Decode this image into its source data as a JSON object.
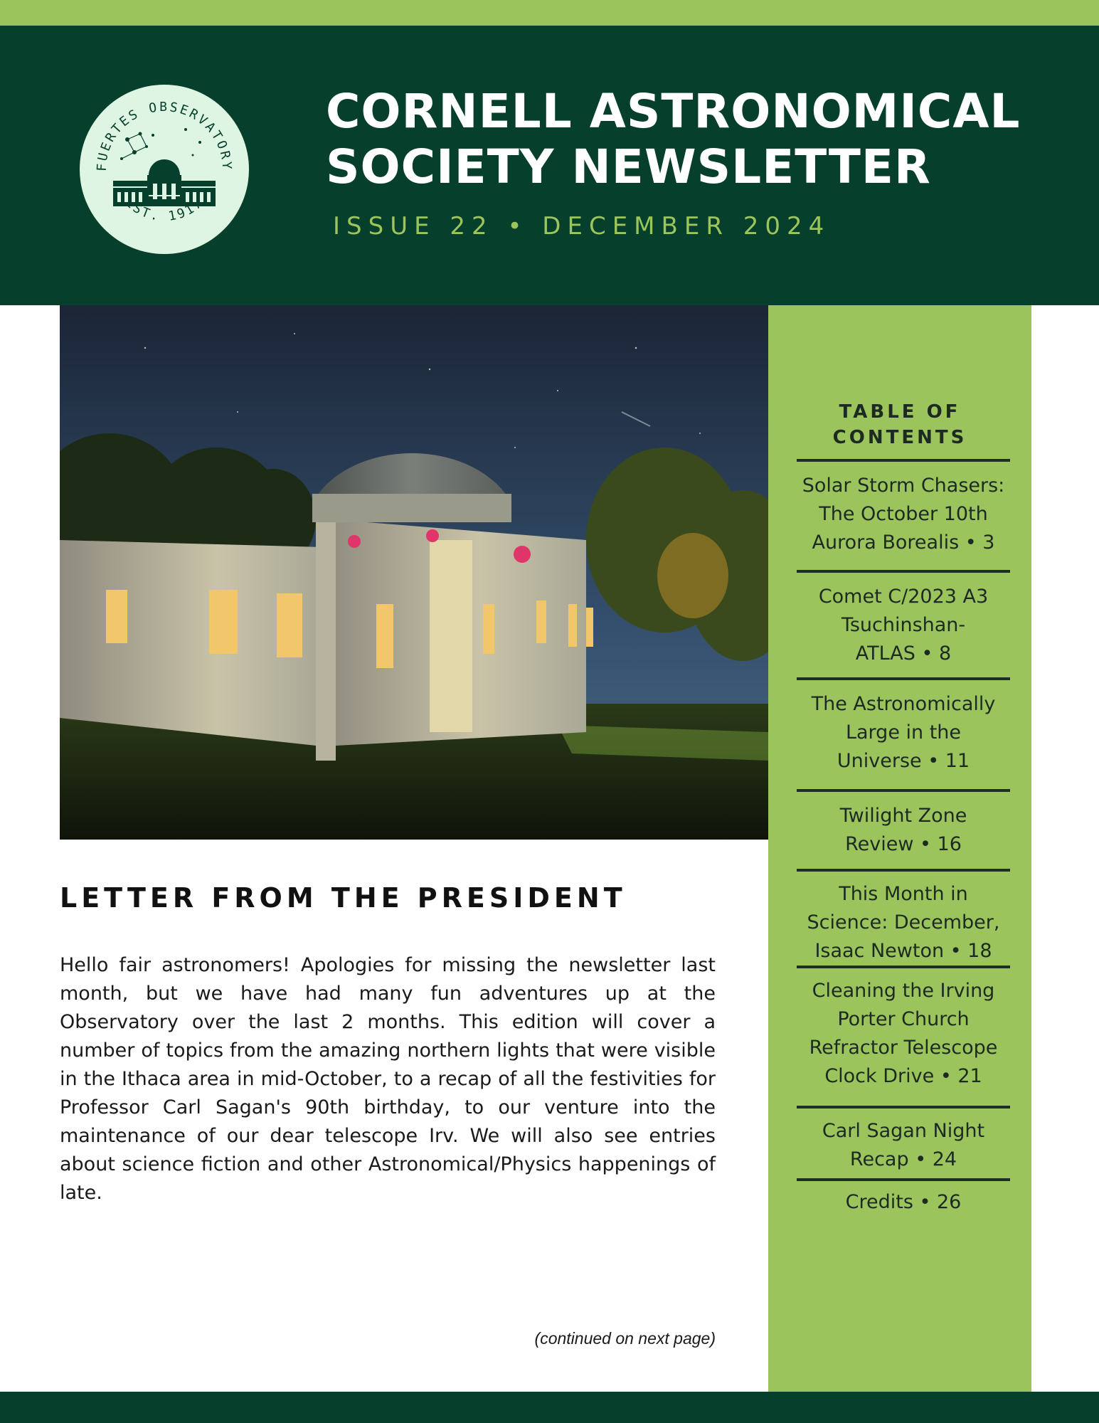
{
  "header": {
    "title_line1": "CORNELL ASTRONOMICAL",
    "title_line2": "SOCIETY NEWSLETTER",
    "issue": "ISSUE 22 • DECEMBER 2024",
    "logo": {
      "top_text": "FUERTES OBSERVATORY",
      "bottom_text": "EST. 1917"
    }
  },
  "colors": {
    "dark_green": "#063f2b",
    "light_green": "#9cc45c",
    "logo_fill": "#dff5e3"
  },
  "photo": {
    "icon": "observatory-night-photo"
  },
  "toc": {
    "heading_line1": "TABLE OF",
    "heading_line2": "CONTENTS",
    "items": [
      {
        "lines": [
          "Solar Storm Chasers:",
          "The October 10th",
          "Aurora Borealis  • 3"
        ]
      },
      {
        "lines": [
          "Comet C/2023 A3",
          "Tsuchinshan-",
          "ATLAS • 8"
        ]
      },
      {
        "lines": [
          "The Astronomically",
          "Large in the",
          "Universe • 11"
        ]
      },
      {
        "lines": [
          "Twilight Zone",
          "Review • 16"
        ]
      },
      {
        "lines": [
          "This Month in",
          "Science: December,",
          "Isaac Newton • 18"
        ]
      },
      {
        "lines": [
          "Cleaning the Irving",
          "Porter Church",
          "Refractor Telescope",
          "Clock Drive •  21"
        ]
      },
      {
        "lines": [
          "Carl Sagan Night",
          "Recap • 24"
        ]
      },
      {
        "lines": [
          "Credits • 26"
        ]
      }
    ]
  },
  "letter": {
    "heading": "LETTER FROM THE PRESIDENT",
    "body": "Hello fair astronomers! Apologies for missing the newsletter last month, but we have had many fun adventures up at the Observatory over the last 2 months. This edition will cover a number of topics from the amazing northern lights that were visible in the Ithaca area in mid-October, to a recap of all the festivities for Professor Carl Sagan's 90th birthday, to our venture into the maintenance of our dear telescope Irv. We will also see entries about science fiction and other Astronomical/Physics happenings of late.",
    "continued": "(continued on next page)"
  }
}
